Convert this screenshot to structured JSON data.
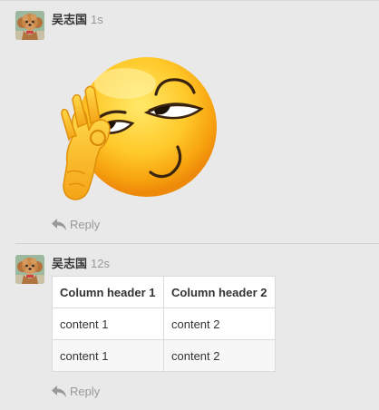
{
  "messages": [
    {
      "author": "吴志国",
      "time": "1s",
      "content_type": "emoji",
      "emoji_icon": "ok-hand-smirk-emoji-icon",
      "reply_label": "Reply"
    },
    {
      "author": "吴志国",
      "time": "12s",
      "content_type": "table",
      "table": {
        "headers": [
          "Column header 1",
          "Column header 2"
        ],
        "rows": [
          [
            "content 1",
            "content 2"
          ],
          [
            "content 1",
            "content 2"
          ]
        ]
      },
      "reply_label": "Reply"
    }
  ],
  "colors": {
    "background": "#e9e9e9",
    "meta_text": "#999999",
    "author_text": "#333333",
    "table_border": "#dadada"
  }
}
